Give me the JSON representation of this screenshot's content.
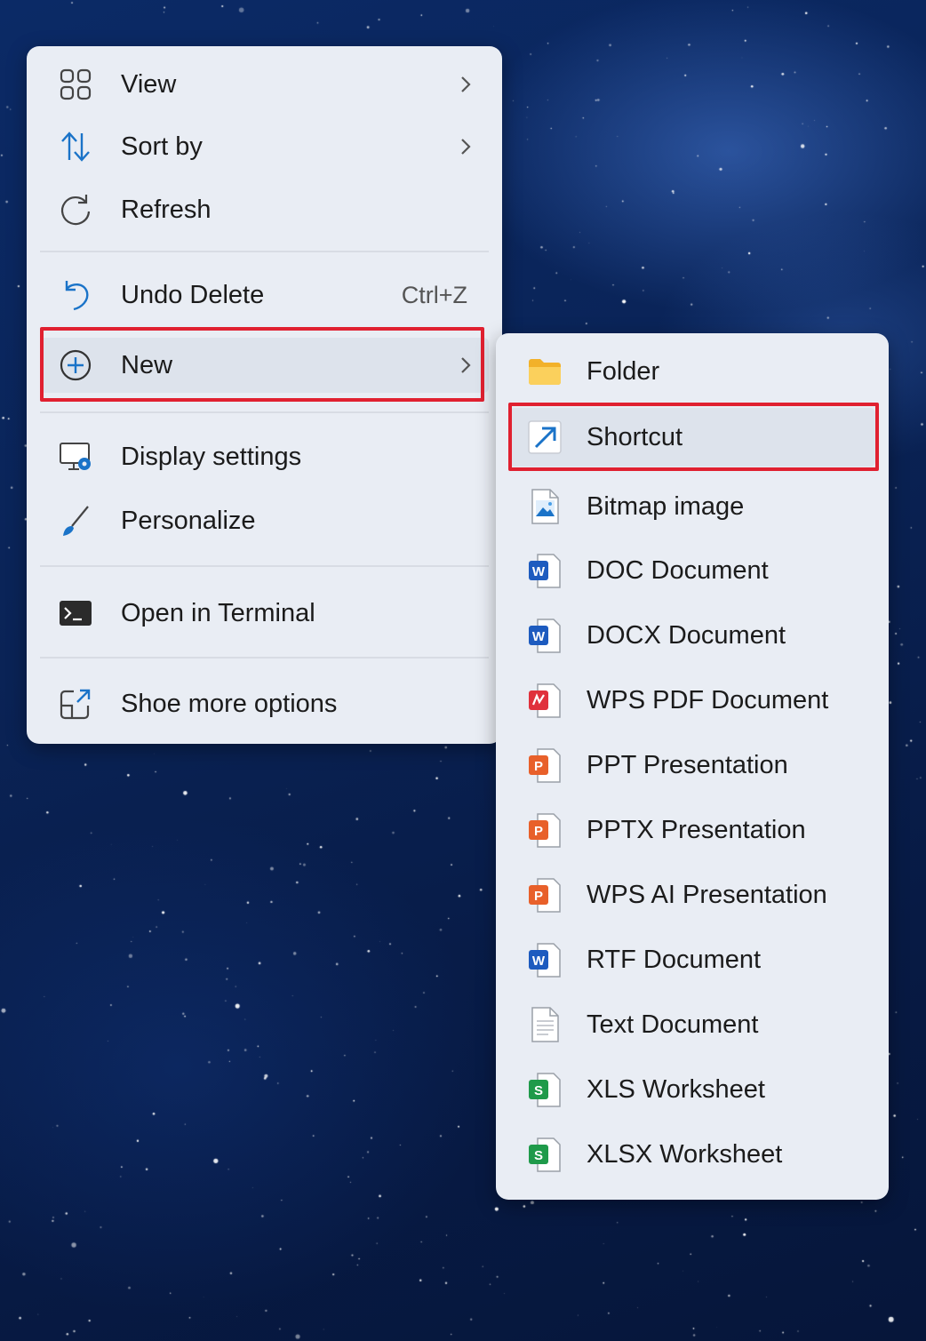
{
  "context_menu": {
    "items": [
      {
        "label": "View",
        "icon": "view-grid-icon"
      },
      {
        "label": "Sort by",
        "icon": "sort-icon"
      },
      {
        "label": "Refresh",
        "icon": "refresh-icon"
      },
      {
        "label": "Undo Delete",
        "icon": "undo-icon",
        "shortcut": "Ctrl+Z"
      },
      {
        "label": "New",
        "icon": "add-circle-icon"
      },
      {
        "label": "Display settings",
        "icon": "display-settings-icon"
      },
      {
        "label": "Personalize",
        "icon": "brush-icon"
      },
      {
        "label": "Open in Terminal",
        "icon": "terminal-icon"
      },
      {
        "label": "Shoe more options",
        "icon": "more-options-icon"
      }
    ]
  },
  "new_submenu": {
    "items": [
      {
        "label": "Folder",
        "icon": "folder-icon"
      },
      {
        "label": "Shortcut",
        "icon": "shortcut-icon"
      },
      {
        "label": "Bitmap image",
        "icon": "bitmap-icon"
      },
      {
        "label": "DOC Document",
        "icon": "word-icon"
      },
      {
        "label": "DOCX Document",
        "icon": "word-icon"
      },
      {
        "label": "WPS PDF Document",
        "icon": "pdf-icon"
      },
      {
        "label": "PPT Presentation",
        "icon": "powerpoint-icon"
      },
      {
        "label": "PPTX Presentation",
        "icon": "powerpoint-icon"
      },
      {
        "label": "WPS AI Presentation",
        "icon": "powerpoint-icon"
      },
      {
        "label": "RTF Document",
        "icon": "word-icon"
      },
      {
        "label": "Text Document",
        "icon": "text-file-icon"
      },
      {
        "label": "XLS Worksheet",
        "icon": "spreadsheet-icon"
      },
      {
        "label": "XLSX Worksheet",
        "icon": "spreadsheet-icon"
      }
    ]
  },
  "colors": {
    "menu_bg": "#e9edf4",
    "highlight_box": "#e02030",
    "accent_blue": "#1a73c8"
  }
}
